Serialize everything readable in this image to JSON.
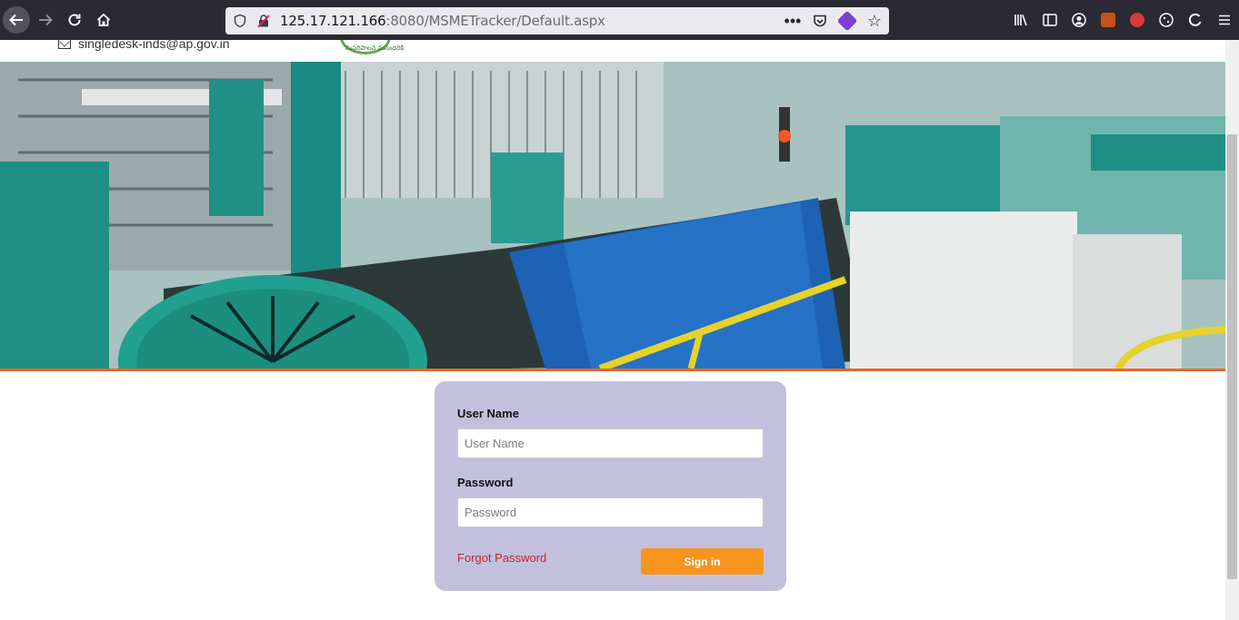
{
  "browser": {
    "url_host": "125.17.121.166",
    "url_rest": ":8080/MSMETracker/Default.aspx"
  },
  "header": {
    "email": "singledesk-inds@ap.gov.in",
    "logo_caption": "సుపరిపాలన మనందరికి"
  },
  "login": {
    "username_label": "User Name",
    "username_placeholder": "User Name",
    "password_label": "Password",
    "password_placeholder": "Password",
    "forgot_password": "Forgot Password",
    "signin_label": "Sign in"
  },
  "colors": {
    "accent_orange": "#f7941d",
    "card_background": "#c3c0dd",
    "link_red": "#c0262d",
    "hero_border": "#e2692b"
  }
}
